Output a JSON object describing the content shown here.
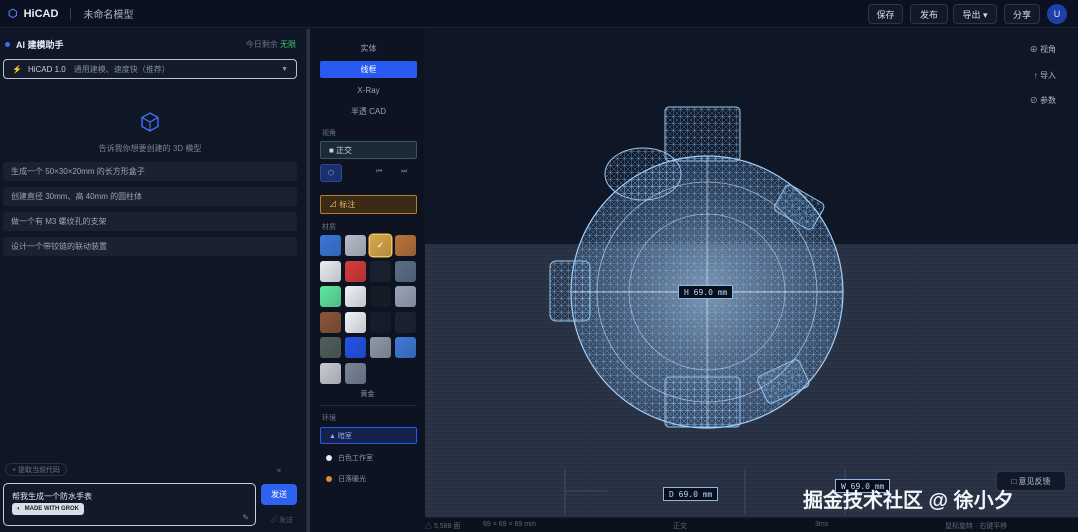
{
  "app": {
    "name": "HiCAD",
    "model_name": "未命名模型"
  },
  "toolbar": {
    "save": "保存",
    "publish": "发布",
    "export": "导出 ▾",
    "share": "分享",
    "avatar": "U"
  },
  "assistant": {
    "title": "AI 建模助手",
    "quota_label": "今日剩余",
    "quota_value": "无限",
    "model": {
      "name": "HiCAD 1.0",
      "desc": "通用建模、速度快（推荐）",
      "caret": "▼"
    },
    "hint": "告诉我你想要创建的 3D 模型",
    "suggestions": [
      "生成一个 50×30×20mm 的长方形盒子",
      "创建直径 30mm、高 40mm 的圆柱体",
      "做一个有 M3 螺纹孔的支架",
      "设计一个带铰链的联动装置"
    ],
    "history_btn": "+ 提取当前代码",
    "history_close": "✕",
    "input_value": "帮我生成一个防水手表",
    "grok_badge": "MADE WITH GROK",
    "send": "发送",
    "shortcut": "⏎ 发送"
  },
  "panel": {
    "modes": [
      "实体",
      "线框",
      "X-Ray",
      "半透 CAD"
    ],
    "active_mode": 1,
    "projection_label": "视角",
    "projection_value": "■ 正交",
    "pill_a": "⬡",
    "pill_b": [
      "⏮",
      "⏭"
    ],
    "annotate": "⊿ 标注",
    "material_label": "材质",
    "materials": [
      "#3a78d8",
      "#b8bec8",
      "#d9a84a",
      "#b8743a",
      "#e9ecf1",
      "#d93a3a",
      "#1a2130",
      "#5a6f86",
      "#5ee6a0",
      "#eef0f4",
      "#151b27",
      "#9aa6b6",
      "#8a5535",
      "#f0f2f6",
      "#161c28",
      "#1c232f",
      "#4f5f5c",
      "#2254e8",
      "#8f98a6",
      "#3f7ad6",
      "#c6cbd3",
      "#7a8494"
    ],
    "selected_material": 2,
    "material_name": "黄金",
    "env_label": "环境",
    "env_active": "▲ 暗室",
    "env_items": [
      {
        "label": "白色工作室",
        "color": "#e8ebf0"
      },
      {
        "label": "日落暖光",
        "color": "#d88a3a"
      }
    ]
  },
  "viewport": {
    "tools": [
      "⊕ 视角",
      "↑ 导入",
      "⊘ 参数"
    ],
    "dim_center": "H 69.0 mm",
    "dim_bottom": "D 69.0 mm",
    "dim_bottom_right": "W 69.0 mm",
    "feedback": "□ 意见反馈",
    "watermark": "掘金技术社区 @ 徐小夕"
  },
  "status": {
    "triangles": "△ 5,588 面",
    "size": "69 × 69 × 69 mm",
    "proj": "正交",
    "time": "3ms",
    "info": "鼠标旋转 · 右键平移"
  }
}
